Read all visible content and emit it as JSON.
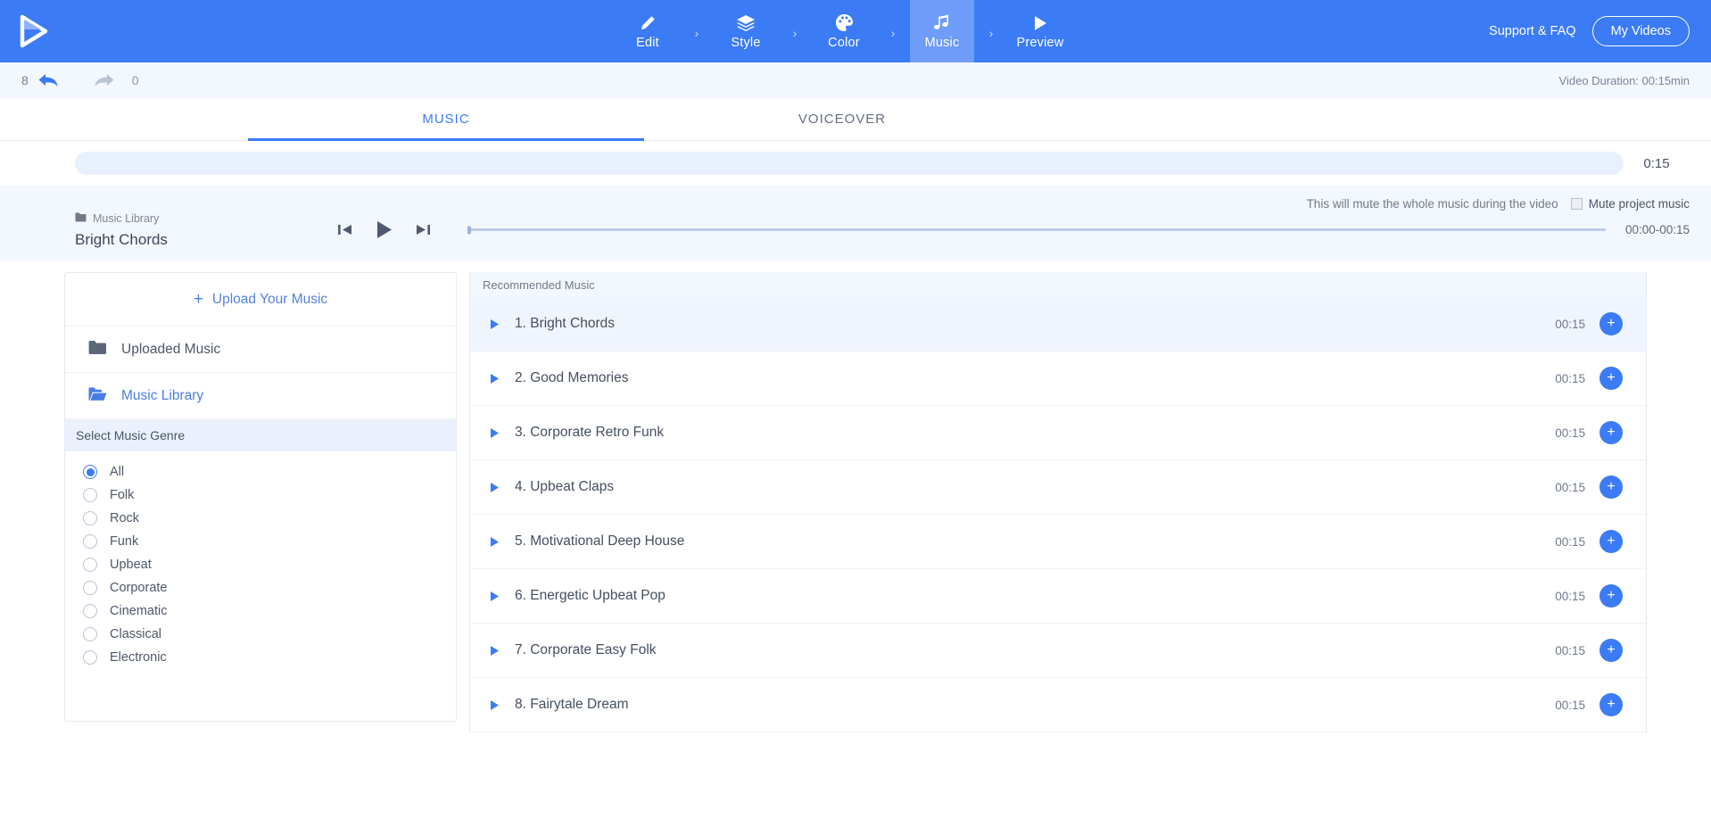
{
  "header": {
    "logo_icon": "play-logo-icon",
    "nav": [
      {
        "label": "Edit",
        "icon": "pencil-icon",
        "active": false
      },
      {
        "label": "Style",
        "icon": "layers-icon",
        "active": false
      },
      {
        "label": "Color",
        "icon": "palette-icon",
        "active": false
      },
      {
        "label": "Music",
        "icon": "music-note-icon",
        "active": true
      },
      {
        "label": "Preview",
        "icon": "play-icon",
        "active": false
      }
    ],
    "nav_separator": "›",
    "support_label": "Support & FAQ",
    "my_videos_label": "My Videos",
    "brand_color": "#3b7bf6",
    "active_nav_color": "#6e9cf8"
  },
  "toolbar": {
    "undo_count": "8",
    "undo_icon": "undo-arrow-icon",
    "redo_count": "0",
    "redo_icon": "redo-arrow-icon",
    "video_duration": "Video Duration: 00:15min"
  },
  "tabs": [
    {
      "label": "MUSIC",
      "active": true
    },
    {
      "label": "VOICEOVER",
      "active": false
    }
  ],
  "timeline": {
    "total_time": "0:15"
  },
  "player": {
    "mute_note": "This will mute the whole music during the video",
    "mute_label": "Mute project music",
    "mute_checked": false,
    "library_icon": "folder-icon",
    "library_label": "Music Library",
    "current_track": "Bright Chords",
    "prev_icon": "skip-back-icon",
    "play_icon": "play-icon",
    "next_icon": "skip-forward-icon",
    "time_range": "00:00-00:15",
    "progress_percent": 0
  },
  "sidebar": {
    "upload_label": "Upload Your Music",
    "upload_icon": "plus-icon",
    "folders": [
      {
        "label": "Uploaded Music",
        "icon": "folder-closed-icon",
        "active": false
      },
      {
        "label": "Music Library",
        "icon": "folder-open-icon",
        "active": true
      }
    ],
    "genre_header": "Select Music Genre",
    "genres": [
      {
        "label": "All",
        "checked": true
      },
      {
        "label": "Folk",
        "checked": false
      },
      {
        "label": "Rock",
        "checked": false
      },
      {
        "label": "Funk",
        "checked": false
      },
      {
        "label": "Upbeat",
        "checked": false
      },
      {
        "label": "Corporate",
        "checked": false
      },
      {
        "label": "Cinematic",
        "checked": false
      },
      {
        "label": "Classical",
        "checked": false
      },
      {
        "label": "Electronic",
        "checked": false
      }
    ]
  },
  "tracklist": {
    "header": "Recommended Music",
    "add_icon": "plus-icon",
    "play_icon": "play-triangle-icon",
    "tracks": [
      {
        "title": "1. Bright Chords",
        "duration": "00:15",
        "selected": true
      },
      {
        "title": "2. Good Memories",
        "duration": "00:15",
        "selected": false
      },
      {
        "title": "3. Corporate Retro Funk",
        "duration": "00:15",
        "selected": false
      },
      {
        "title": "4. Upbeat Claps",
        "duration": "00:15",
        "selected": false
      },
      {
        "title": "5. Motivational Deep House",
        "duration": "00:15",
        "selected": false
      },
      {
        "title": "6. Energetic Upbeat Pop",
        "duration": "00:15",
        "selected": false
      },
      {
        "title": "7. Corporate Easy Folk",
        "duration": "00:15",
        "selected": false
      },
      {
        "title": "8. Fairytale Dream",
        "duration": "00:15",
        "selected": false
      }
    ]
  }
}
